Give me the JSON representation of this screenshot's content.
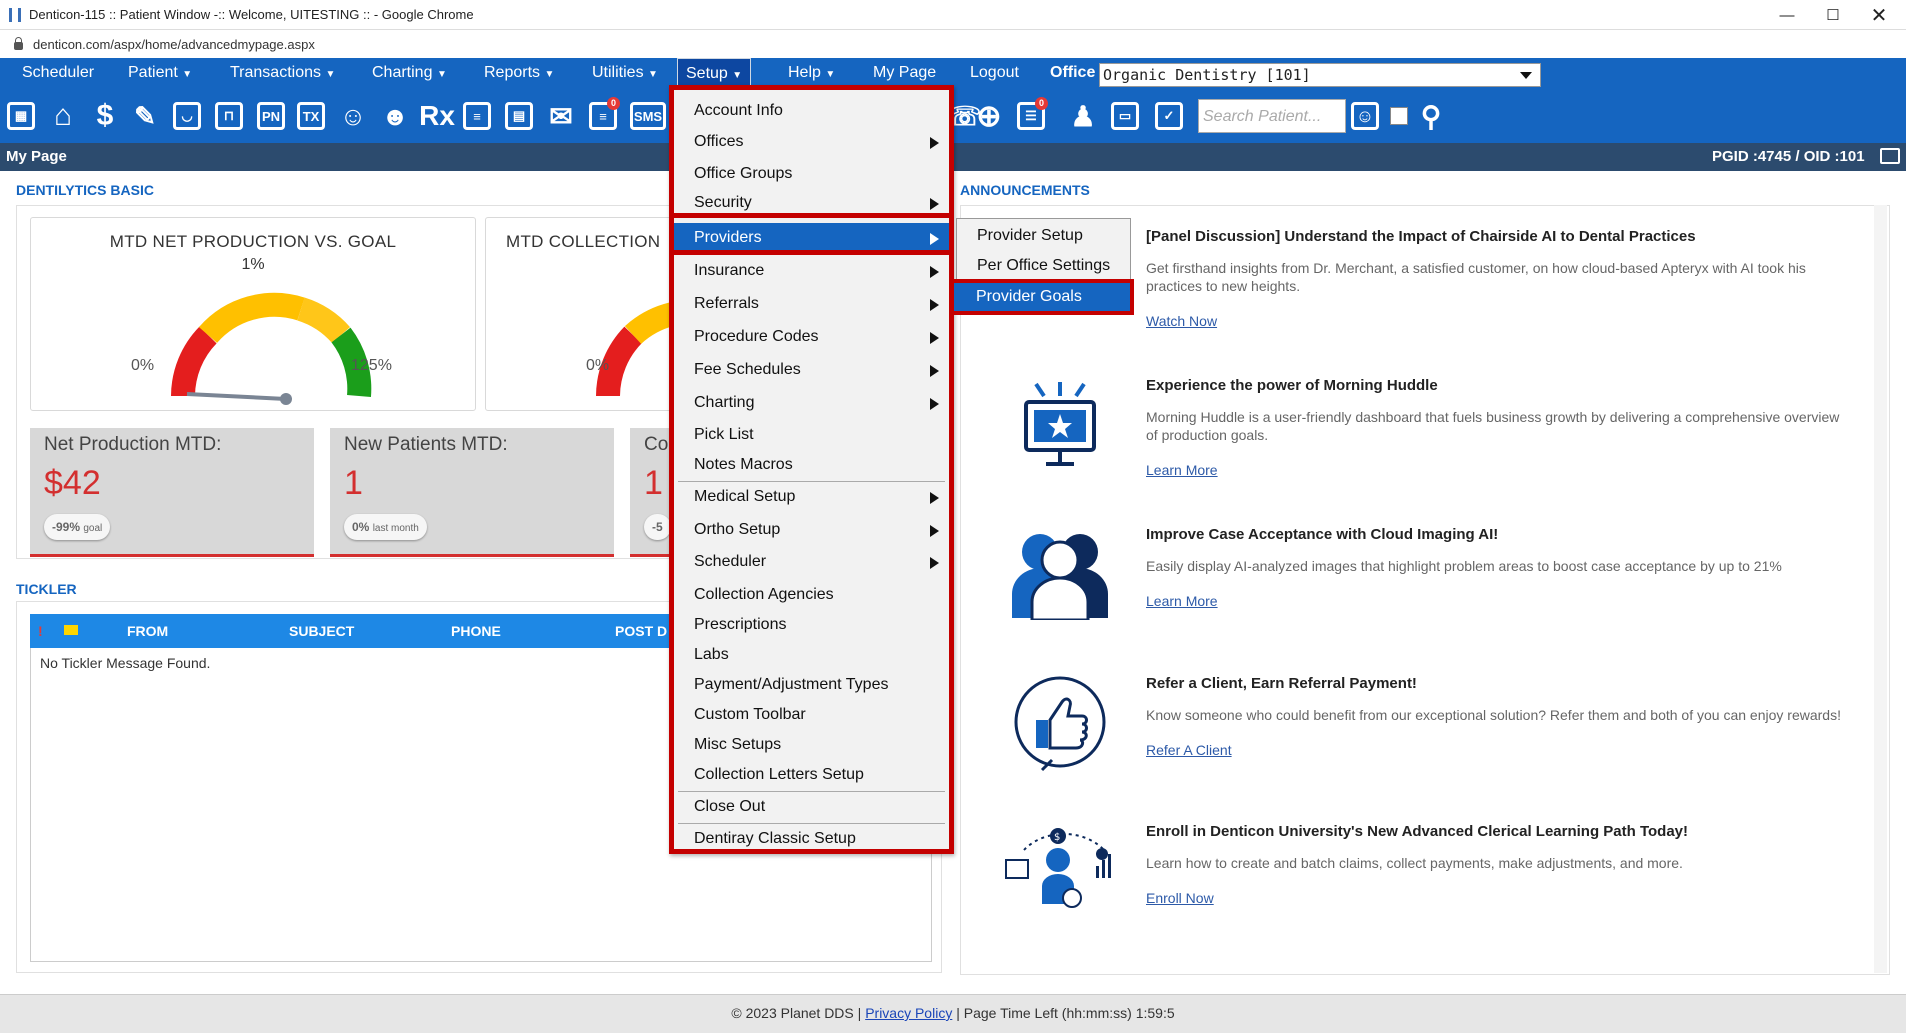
{
  "window": {
    "title": "Denticon-115 :: Patient Window -:: Welcome, UITESTING :: - Google Chrome",
    "url": "denticon.com/aspx/home/advancedmypage.aspx"
  },
  "menu": {
    "items": [
      "Scheduler",
      "Patient",
      "Transactions",
      "Charting",
      "Reports",
      "Utilities",
      "Setup",
      "Help",
      "My Page",
      "Logout"
    ],
    "office_label": "Office",
    "office_value": "Organic Dentistry [101]"
  },
  "toolbar": {
    "search_placeholder": "Search Patient...",
    "badges": [
      "0",
      "0",
      "0"
    ],
    "text_icons": [
      "PN",
      "TX",
      "Rx",
      "SMS"
    ]
  },
  "pagebar": {
    "title": "My Page",
    "ids": "PGID :4745  /  OID :101"
  },
  "dentilytics": {
    "title": "DENTILYTICS BASIC",
    "gauge1": {
      "title": "MTD NET PRODUCTION VS. GOAL",
      "pct": "1%",
      "min": "0%",
      "max": "125%"
    },
    "gauge2": {
      "title": "MTD COLLECTION",
      "min": "0%"
    },
    "stats": [
      {
        "label": "Net Production MTD:",
        "value": "$42",
        "chip_bold": "-99%",
        "chip_small": "goal"
      },
      {
        "label": "New Patients MTD:",
        "value": "1",
        "chip_bold": "0%",
        "chip_small": "last month"
      },
      {
        "label": "Co",
        "value": "1",
        "chip_bold": "-5",
        "chip_small": ""
      }
    ]
  },
  "tickler": {
    "title": "TICKLER",
    "columns": [
      "FROM",
      "SUBJECT",
      "PHONE",
      "POST D"
    ],
    "empty": "No Tickler Message Found."
  },
  "announcements": {
    "title": "ANNOUNCEMENTS",
    "items": [
      {
        "title": "[Panel Discussion] Understand the Impact of Chairside AI to Dental Practices",
        "desc": "Get firsthand insights from Dr. Merchant, a satisfied customer, on how cloud-based Apteryx with AI took his practices to new heights.",
        "link": "Watch Now",
        "icon": "video-icon"
      },
      {
        "title": "Experience the power of Morning Huddle",
        "desc": "Morning Huddle is a user-friendly dashboard that fuels business growth by delivering a comprehensive overview of production goals.",
        "link": "Learn More",
        "icon": "monitor-star-icon"
      },
      {
        "title": "Improve Case Acceptance with Cloud Imaging AI!",
        "desc": "Easily display AI-analyzed images that highlight problem areas to boost case acceptance by up to 21%",
        "link": "Learn More",
        "icon": "people-icon"
      },
      {
        "title": "Refer a Client, Earn Referral Payment!",
        "desc": "Know someone who could benefit from our exceptional solution? Refer them and both of you can enjoy rewards!",
        "link": "Refer A Client",
        "icon": "thumbs-up-icon"
      },
      {
        "title": "Enroll in Denticon University's New Advanced Clerical Learning Path Today!",
        "desc": "Learn how to create and batch claims, collect payments, make adjustments, and more.",
        "link": "Enroll Now",
        "icon": "learner-icon"
      }
    ]
  },
  "setup_menu": {
    "items": [
      {
        "label": "Account Info",
        "sub": false
      },
      {
        "label": "Offices",
        "sub": true
      },
      {
        "label": "Office Groups",
        "sub": false
      },
      {
        "label": "Security",
        "sub": true
      },
      {
        "label": "Providers",
        "sub": true
      },
      {
        "label": "Insurance",
        "sub": true
      },
      {
        "label": "Referrals",
        "sub": true
      },
      {
        "label": "Procedure Codes",
        "sub": true
      },
      {
        "label": "Fee Schedules",
        "sub": true
      },
      {
        "label": "Charting",
        "sub": true
      },
      {
        "label": "Pick List",
        "sub": false
      },
      {
        "label": "Notes Macros",
        "sub": false
      },
      {
        "label": "Medical Setup",
        "sub": true
      },
      {
        "label": "Ortho Setup",
        "sub": true
      },
      {
        "label": "Scheduler",
        "sub": true
      },
      {
        "label": "Collection Agencies",
        "sub": false
      },
      {
        "label": "Prescriptions",
        "sub": false
      },
      {
        "label": "Labs",
        "sub": false
      },
      {
        "label": "Payment/Adjustment Types",
        "sub": false
      },
      {
        "label": "Custom Toolbar",
        "sub": false
      },
      {
        "label": "Misc Setups",
        "sub": false
      },
      {
        "label": "Collection Letters Setup",
        "sub": false
      },
      {
        "label": "Close Out",
        "sub": false
      },
      {
        "label": "Dentiray Classic Setup",
        "sub": false
      }
    ],
    "providers_submenu": [
      "Provider Setup",
      "Per Office Settings",
      "Provider Goals"
    ]
  },
  "footer": {
    "copyright": "© 2023 Planet DDS |",
    "privacy": "Privacy Policy",
    "time_left": "| Page Time Left (hh:mm:ss) 1:59:5"
  },
  "colors": {
    "brand": "#1565c0",
    "highlight": "#c40000",
    "value_red": "#d32f2f"
  }
}
